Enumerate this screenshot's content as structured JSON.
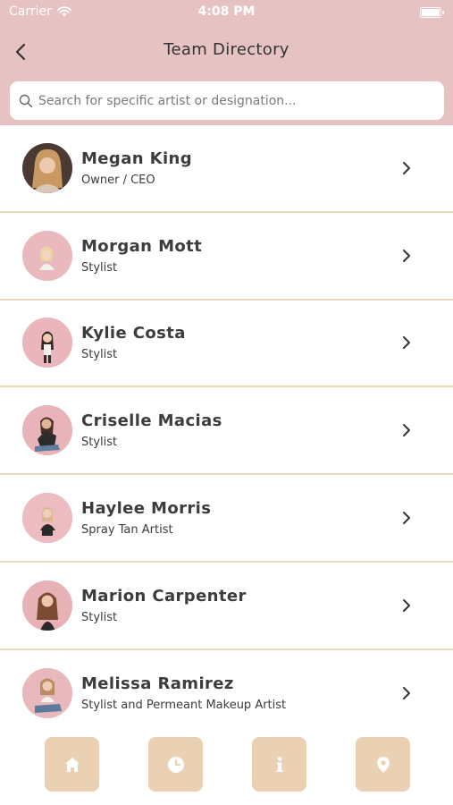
{
  "status_bar": {
    "carrier": "Carrier",
    "time": "4:08 PM"
  },
  "header": {
    "back_icon": "chevron-left-icon",
    "title": "Team Directory"
  },
  "search": {
    "placeholder": "Search for specific artist or designation..."
  },
  "team": [
    {
      "name": "Megan King",
      "role": "Owner / CEO"
    },
    {
      "name": "Morgan Mott",
      "role": "Stylist"
    },
    {
      "name": "Kylie Costa",
      "role": "Stylist"
    },
    {
      "name": "Criselle Macias",
      "role": "Stylist"
    },
    {
      "name": "Haylee Morris",
      "role": "Spray Tan Artist"
    },
    {
      "name": "Marion Carpenter",
      "role": "Stylist"
    },
    {
      "name": "Melissa Ramirez",
      "role": "Stylist and Permeant Makeup Artist"
    }
  ],
  "tab_bar": {
    "tabs": [
      "home-icon",
      "clock-icon",
      "info-icon",
      "location-pin-icon"
    ]
  },
  "colors": {
    "header_bg": "#e7c2c3",
    "divider": "#ead9b9",
    "tab_bg": "#ead1b3",
    "text": "#3c3c3c"
  }
}
